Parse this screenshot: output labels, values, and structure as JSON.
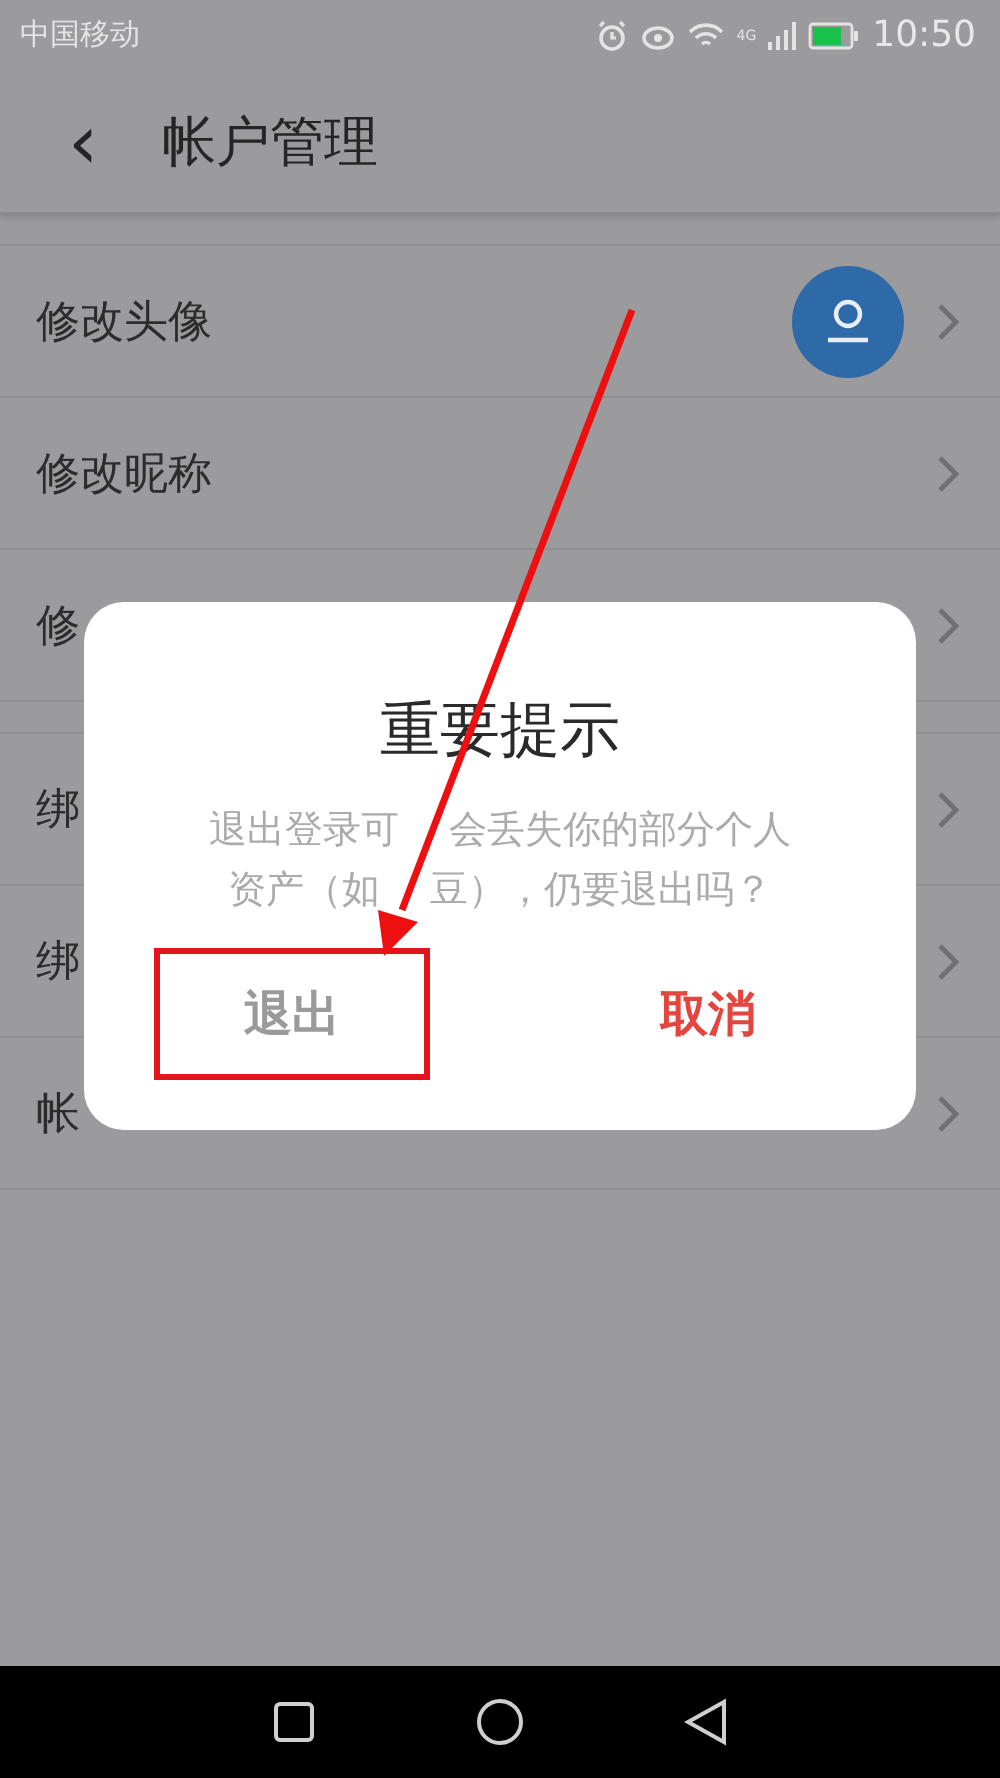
{
  "status_bar": {
    "carrier": "中国移动",
    "network": "4G",
    "time": "10:50"
  },
  "header": {
    "back": "‹",
    "title": "帐户管理"
  },
  "groups": [
    [
      {
        "label": "修改头像",
        "kind": "avatar"
      },
      {
        "label": "修改昵称",
        "kind": "plain"
      },
      {
        "label": "修",
        "kind": "plain"
      }
    ],
    [
      {
        "label": "绑",
        "kind": "plain"
      },
      {
        "label": "绑",
        "kind": "plain"
      },
      {
        "label": "帐",
        "kind": "plain"
      }
    ]
  ],
  "dialog": {
    "title": "重要提示",
    "message_lines": [
      [
        "退出登录可",
        "会丢失你的部分个人"
      ],
      [
        "资产（如",
        "豆），仍要退出吗？"
      ]
    ],
    "buttons": [
      {
        "label": "退出",
        "kind": "confirm",
        "highlighted": true
      },
      {
        "label": "取消",
        "kind": "cancel",
        "highlighted": false
      }
    ]
  }
}
